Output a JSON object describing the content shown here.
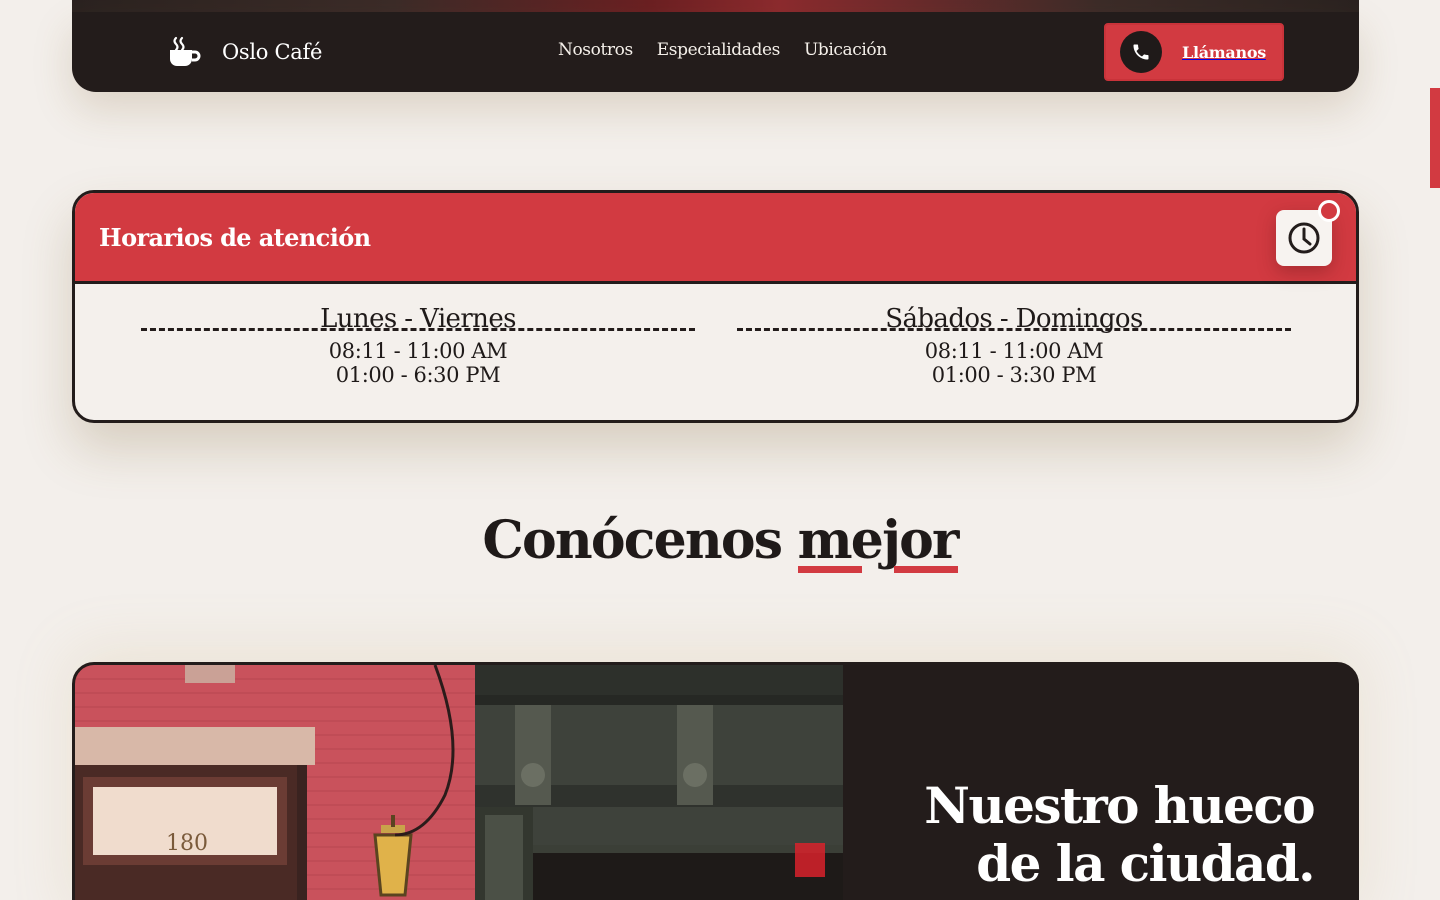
{
  "brand": {
    "name": "Oslo Café",
    "logo_icon": "coffee-cup-icon"
  },
  "nav": {
    "links": [
      "Nosotros",
      "Especialidades",
      "Ubicación"
    ]
  },
  "call_button": {
    "label": "Llámanos",
    "icon": "phone-icon"
  },
  "hours": {
    "title": "Horarios de atención",
    "icon": "clock-icon",
    "schedules": [
      {
        "days": "Lunes - Viernes",
        "times": [
          "08:11 - 11:00 AM",
          "01:00 - 6:30 PM"
        ]
      },
      {
        "days": "Sábados - Domingos",
        "times": [
          "08:11 - 11:00 AM",
          "01:00 - 3:30 PM"
        ]
      }
    ]
  },
  "about": {
    "section_title_prefix": "Conócenos",
    "section_title_highlight": "mejor",
    "heading_line1": "Nuestro hueco",
    "heading_line2": "de la ciudad.",
    "photo_number": "180"
  },
  "colors": {
    "accent": "#d23a41",
    "dark": "#231c1b",
    "background": "#f3efeb"
  }
}
